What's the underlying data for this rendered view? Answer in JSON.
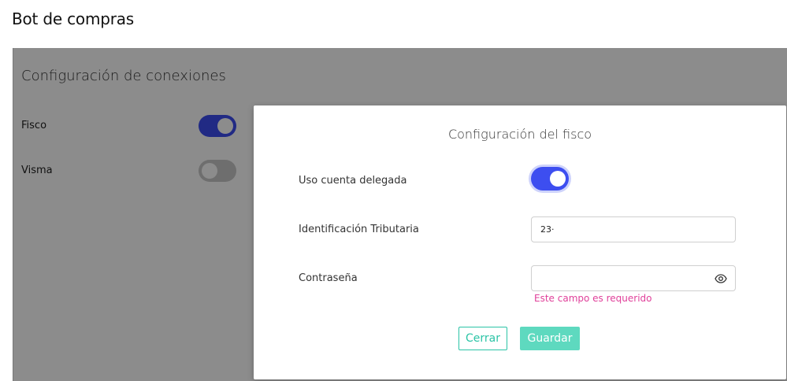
{
  "page": {
    "title": "Bot de compras"
  },
  "connections": {
    "title": "Configuración de conexiones",
    "items": [
      {
        "label": "Fisco",
        "enabled": true
      },
      {
        "label": "Visma",
        "enabled": false
      }
    ]
  },
  "modal": {
    "title": "Configuración del fisco",
    "delegated_label": "Uso cuenta delegada",
    "delegated_enabled": true,
    "tax_id_label": "Identificación Tributaria",
    "tax_id_value": "23·",
    "password_label": "Contraseña",
    "password_value": "",
    "password_error": "Este campo es requerido",
    "password_icon": "eye-icon",
    "cancel_label": "Cerrar",
    "save_label": "Guardar"
  },
  "colors": {
    "toggle_on": "#3d4ef0",
    "toggle_off": "#c9c9c9",
    "accent": "#2bc4a6",
    "save_disabled": "#5ed9bf",
    "error": "#e0409a"
  }
}
